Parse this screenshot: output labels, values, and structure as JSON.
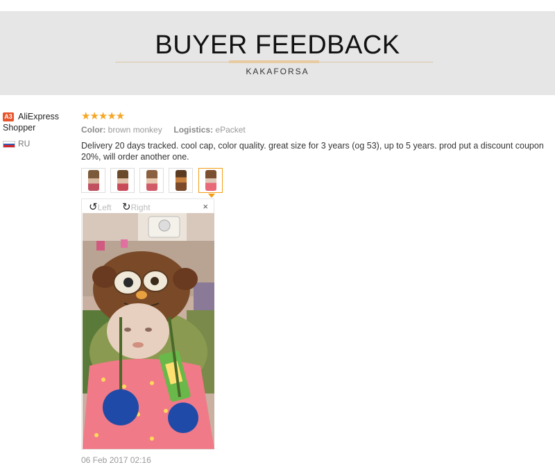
{
  "banner": {
    "title": "BUYER FEEDBACK",
    "subtitle": "KAKAFORSA"
  },
  "reviewer": {
    "badge": "A3",
    "name_line1": "AliExpress",
    "name_line2": "Shopper",
    "country": "RU"
  },
  "review": {
    "rating": 5,
    "stars": "★★★★★",
    "color_label": "Color:",
    "color_value": "brown monkey",
    "logistics_label": "Logistics:",
    "logistics_value": "ePacket",
    "text": "Delivery 20 days tracked. cool cap, color quality. great size for 3 years (og 53), up to 5 years. prod put a discount coupon 20%, will order another one.",
    "date": "06 Feb 2017 02:16"
  },
  "viewer": {
    "rotate_left": "Left",
    "rotate_right": "Right",
    "close": "×"
  },
  "colors": {
    "accent": "#f39c12",
    "star": "#f5a623",
    "badge": "#e8542b",
    "banner_bg": "#e6e6e6"
  }
}
